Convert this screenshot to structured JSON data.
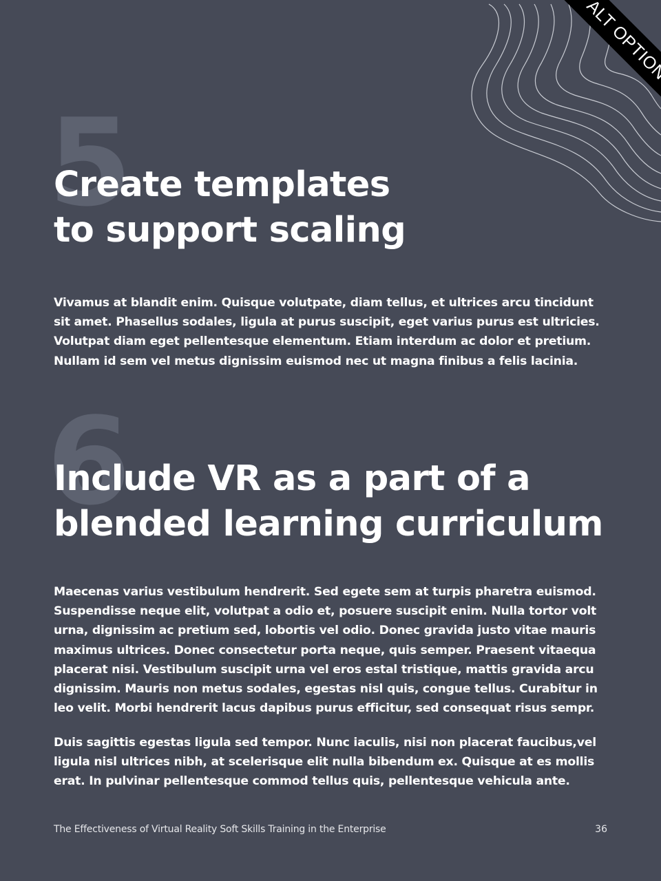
{
  "ribbon": {
    "label": "ALT OPTION"
  },
  "sections": [
    {
      "number": "5",
      "heading_lines": [
        "Create templates",
        "to support scaling"
      ],
      "paragraphs": [
        "Vivamus at blandit enim. Quisque volutpate, diam tellus, et ultrices arcu tincidunt sit amet. Phasellus sodales, ligula at purus suscipit, eget varius purus est ultricies. Volutpat diam eget pellentesque elementum. Etiam interdum ac dolor et pretium. Nullam id sem vel metus dignissim euismod nec ut magna finibus a felis lacinia."
      ]
    },
    {
      "number": "6",
      "heading_lines": [
        "Include VR as a part of a",
        "blended learning curriculum"
      ],
      "paragraphs": [
        "Maecenas varius vestibulum hendrerit. Sed egete sem at turpis pharetra euismod. Suspendisse neque elit, volutpat a odio et, posuere suscipit enim. Nulla tortor volt urna, dignissim ac pretium sed, lobortis vel odio. Donec gravida justo vitae mauris maximus ultrices. Donec consectetur porta neque, quis semper. Praesent vitaequa placerat nisi. Vestibulum suscipit urna vel eros estal tristique, mattis gravida arcu dignissim. Mauris non metus sodales, egestas nisl quis, congue tellus. Curabitur in leo velit. Morbi hendrerit lacus dapibus purus efficitur, sed consequat risus sempr.",
        "Duis sagittis egestas ligula sed tempor. Nunc iaculis, nisi non placerat faucibus,vel ligula nisl ultrices nibh, at scelerisque elit nulla bibendum ex. Quisque at es mollis erat. In pulvinar pellentesque commod tellus quis, pellentesque vehicula ante."
      ]
    }
  ],
  "footer": {
    "title": "The Effectiveness of Virtual Reality Soft Skills Training in the Enterprise",
    "page_number": "36"
  },
  "colors": {
    "background": "#464a57",
    "number_watermark": "#5d6270",
    "text": "#ffffff",
    "ribbon": "#000000"
  },
  "icons": {
    "decoration": "topographic-lines-icon"
  }
}
